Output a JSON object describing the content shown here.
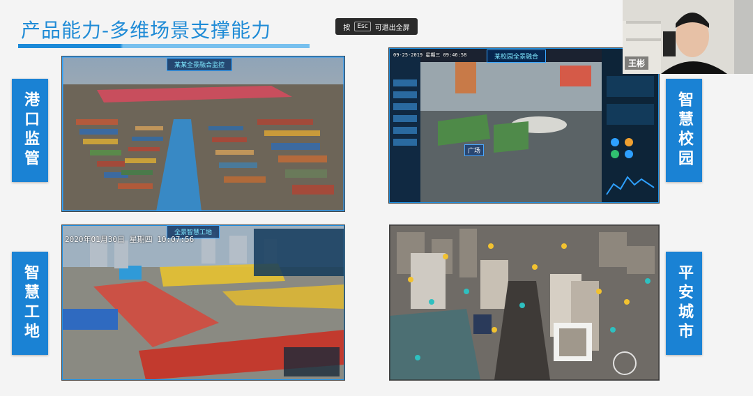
{
  "slide": {
    "title": "产品能力-多维场景支撑能力"
  },
  "toast": {
    "prefix": "按",
    "key": "Esc",
    "suffix": "可退出全屏"
  },
  "labels": {
    "port": "港口监管",
    "campus": "智慧校园",
    "site": "智慧工地",
    "city": "平安城市"
  },
  "panels": {
    "port": {
      "header": "某某全景融合监控"
    },
    "campus": {
      "header": "某校园全景融合",
      "datetime": "09-25-2019 星期三 09:46:58",
      "tag": "广场"
    },
    "site": {
      "header": "全景智慧工地",
      "datetime": "2020年01月30日 星期四 10:07:56"
    },
    "city": {}
  },
  "webcam": {
    "name": "王彬"
  }
}
